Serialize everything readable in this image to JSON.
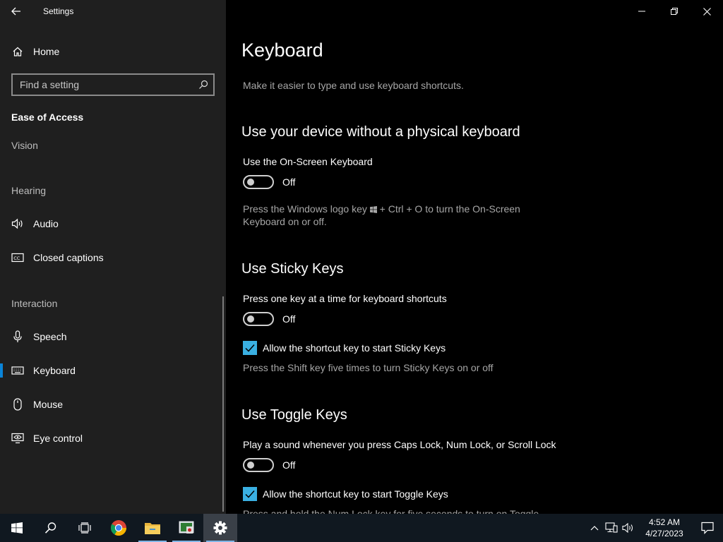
{
  "window": {
    "title": "Settings"
  },
  "sidebar": {
    "home_label": "Home",
    "search_placeholder": "Find a setting",
    "section_title": "Ease of Access",
    "groups": {
      "vision": "Vision",
      "hearing": "Hearing",
      "interaction": "Interaction"
    },
    "items": {
      "audio": "Audio",
      "closed_captions": "Closed captions",
      "speech": "Speech",
      "keyboard": "Keyboard",
      "mouse": "Mouse",
      "eye_control": "Eye control"
    },
    "selected_item": "Keyboard"
  },
  "main": {
    "title": "Keyboard",
    "description": "Make it easier to type and use keyboard shortcuts.",
    "osk": {
      "heading": "Use your device without a physical keyboard",
      "label": "Use the On-Screen Keyboard",
      "state": "Off",
      "hint_before": "Press the Windows logo key",
      "hint_after": " + Ctrl + O to turn the On-Screen Keyboard on or off."
    },
    "sticky": {
      "heading": "Use Sticky Keys",
      "label": "Press one key at a time for keyboard shortcuts",
      "state": "Off",
      "checkbox_label": "Allow the shortcut key to start Sticky Keys",
      "checkbox_checked": true,
      "hint": "Press the Shift key five times to turn Sticky Keys on or off"
    },
    "toggle_keys": {
      "heading": "Use Toggle Keys",
      "label": "Play a sound whenever you press Caps Lock, Num Lock, or Scroll Lock",
      "state": "Off",
      "checkbox_label": "Allow the shortcut key to start Toggle Keys",
      "checkbox_checked": true,
      "hint": "Press and hold the Num Lock key for five seconds to turn on Toggle"
    }
  },
  "taskbar": {
    "apps": [
      "start-icon",
      "search-icon",
      "task-view-icon",
      "chrome-icon",
      "file-explorer-icon",
      "app-icon",
      "settings-icon"
    ],
    "clock": {
      "time": "4:52 AM",
      "date": "4/27/2023"
    }
  },
  "colors": {
    "accent": "#0a84d8",
    "checkbox": "#3ab0e2",
    "sidebar_bg": "#1f1f1f",
    "main_bg": "#000000",
    "taskbar_bg": "#101820"
  }
}
